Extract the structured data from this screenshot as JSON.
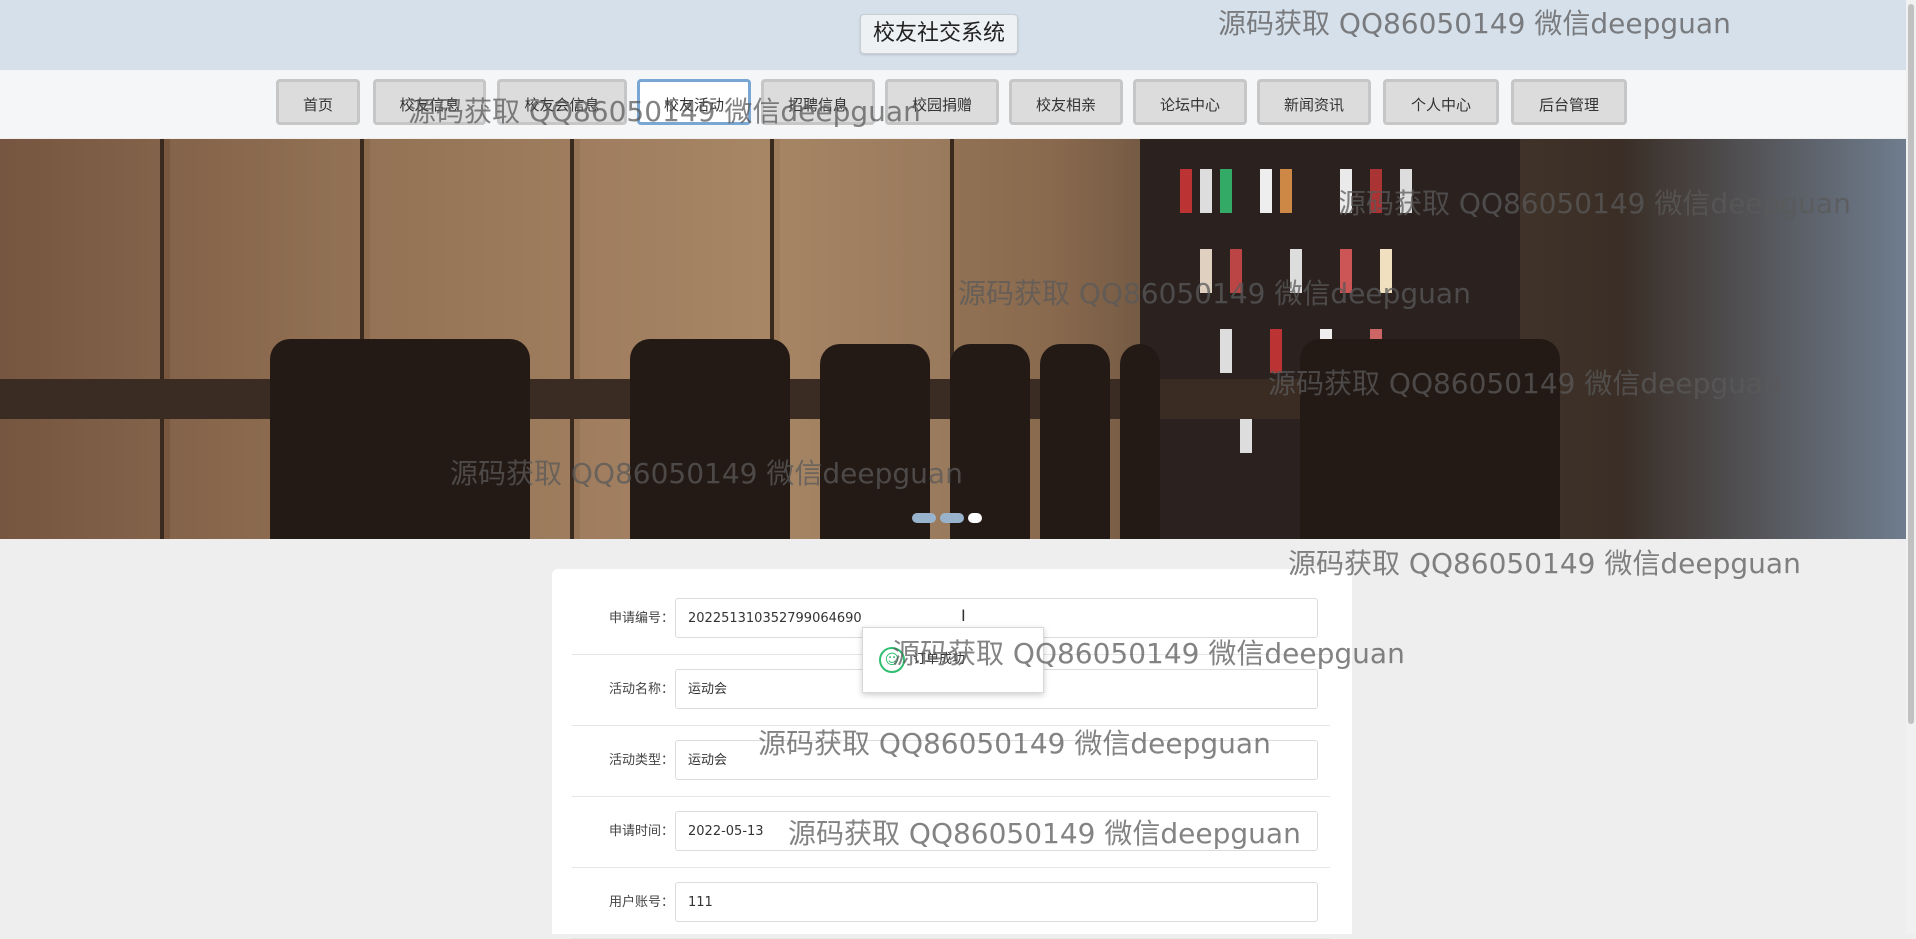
{
  "site": {
    "title": "校友社交系统"
  },
  "nav": {
    "items": [
      {
        "label": "首页"
      },
      {
        "label": "校友信息"
      },
      {
        "label": "校友会信息"
      },
      {
        "label": "校友活动"
      },
      {
        "label": "招聘信息"
      },
      {
        "label": "校园捐赠"
      },
      {
        "label": "校友相亲"
      },
      {
        "label": "论坛中心"
      },
      {
        "label": "新闻资讯"
      },
      {
        "label": "个人中心"
      },
      {
        "label": "后台管理"
      }
    ],
    "active": "校友活动"
  },
  "banner": {
    "slide_count": 3,
    "current_slide": 3
  },
  "form": {
    "fields": [
      {
        "label": "申请编号：",
        "value": "202251310352799064690"
      },
      {
        "label": "活动名称：",
        "value": "运动会"
      },
      {
        "label": "活动类型：",
        "value": "运动会"
      },
      {
        "label": "申请时间：",
        "value": "2022-05-13"
      },
      {
        "label": "用户账号：",
        "value": "111"
      }
    ]
  },
  "toast": {
    "text": "订单成功",
    "icon": "smile-icon"
  },
  "watermark": {
    "text": "源码获取 QQ86050149 微信deepguan"
  },
  "colors": {
    "accent": "#7aa6d4",
    "success": "#2fbf71",
    "header_bg": "#d6e0ea"
  }
}
